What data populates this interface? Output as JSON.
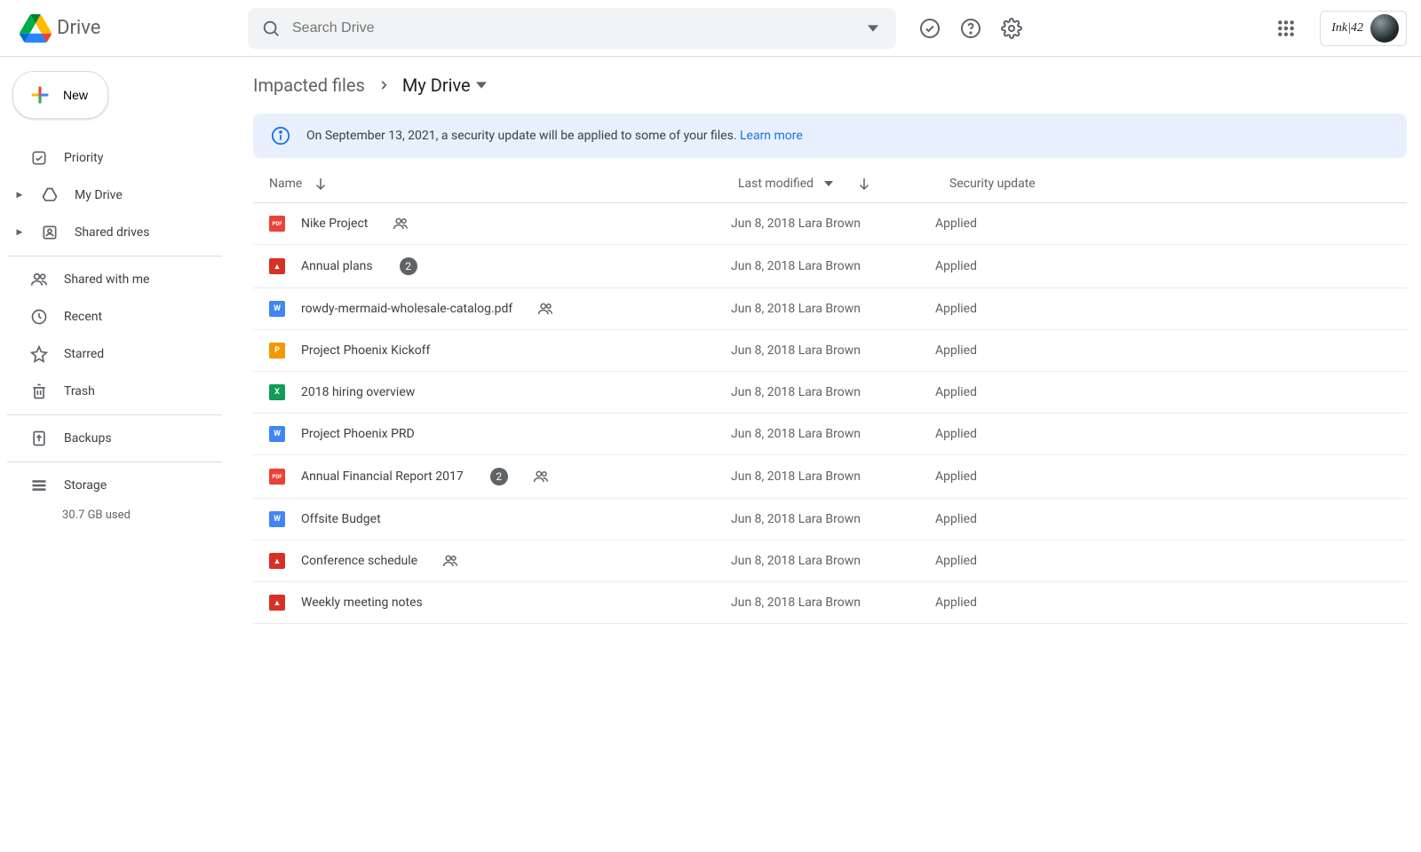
{
  "header": {
    "product": "Drive",
    "search_placeholder": "Search Drive",
    "chip_text": "Ink|42"
  },
  "sidebar": {
    "new_label": "New",
    "items": [
      {
        "label": "Priority"
      },
      {
        "label": "My Drive"
      },
      {
        "label": "Shared drives"
      }
    ],
    "items2": [
      {
        "label": "Shared with me"
      },
      {
        "label": "Recent"
      },
      {
        "label": "Starred"
      },
      {
        "label": "Trash"
      }
    ],
    "backups": "Backups",
    "storage_label": "Storage",
    "storage_detail": "30.7 GB used"
  },
  "crumbs": {
    "root": "Impacted files",
    "current": "My Drive"
  },
  "banner": {
    "text": "On September 13, 2021, a security update will be applied to some of your files. ",
    "link": "Learn more"
  },
  "columns": {
    "name": "Name",
    "modified": "Last modified",
    "security": "Security update"
  },
  "rows": [
    {
      "icon": "pdf",
      "glyph": "PDF",
      "name": "Nike Project",
      "badge": null,
      "shared": true,
      "modified": "Jun 8, 2018 Lara Brown",
      "status": "Applied"
    },
    {
      "icon": "img",
      "glyph": "▲",
      "name": "Annual plans",
      "badge": "2",
      "shared": false,
      "modified": "Jun 8, 2018 Lara Brown",
      "status": "Applied"
    },
    {
      "icon": "doc",
      "glyph": "W",
      "name": "rowdy-mermaid-wholesale-catalog.pdf",
      "badge": null,
      "shared": true,
      "modified": "Jun 8, 2018 Lara Brown",
      "status": "Applied"
    },
    {
      "icon": "slide",
      "glyph": "P",
      "name": "Project Phoenix Kickoff",
      "badge": null,
      "shared": false,
      "modified": "Jun 8, 2018 Lara Brown",
      "status": "Applied"
    },
    {
      "icon": "sheet",
      "glyph": "X",
      "name": "2018 hiring overview",
      "badge": null,
      "shared": false,
      "modified": "Jun 8, 2018 Lara Brown",
      "status": "Applied"
    },
    {
      "icon": "doc",
      "glyph": "W",
      "name": "Project Phoenix PRD",
      "badge": null,
      "shared": false,
      "modified": "Jun 8, 2018 Lara Brown",
      "status": "Applied"
    },
    {
      "icon": "pdf",
      "glyph": "PDF",
      "name": "Annual Financial Report 2017",
      "badge": "2",
      "shared": true,
      "modified": "Jun 8, 2018 Lara Brown",
      "status": "Applied"
    },
    {
      "icon": "doc",
      "glyph": "W",
      "name": "Offsite Budget",
      "badge": null,
      "shared": false,
      "modified": "Jun 8, 2018 Lara Brown",
      "status": "Applied"
    },
    {
      "icon": "img",
      "glyph": "▲",
      "name": "Conference schedule",
      "badge": null,
      "shared": true,
      "modified": "Jun 8, 2018 Lara Brown",
      "status": "Applied"
    },
    {
      "icon": "img",
      "glyph": "▲",
      "name": "Weekly meeting notes",
      "badge": null,
      "shared": false,
      "modified": "Jun 8, 2018 Lara Brown",
      "status": "Applied"
    }
  ]
}
